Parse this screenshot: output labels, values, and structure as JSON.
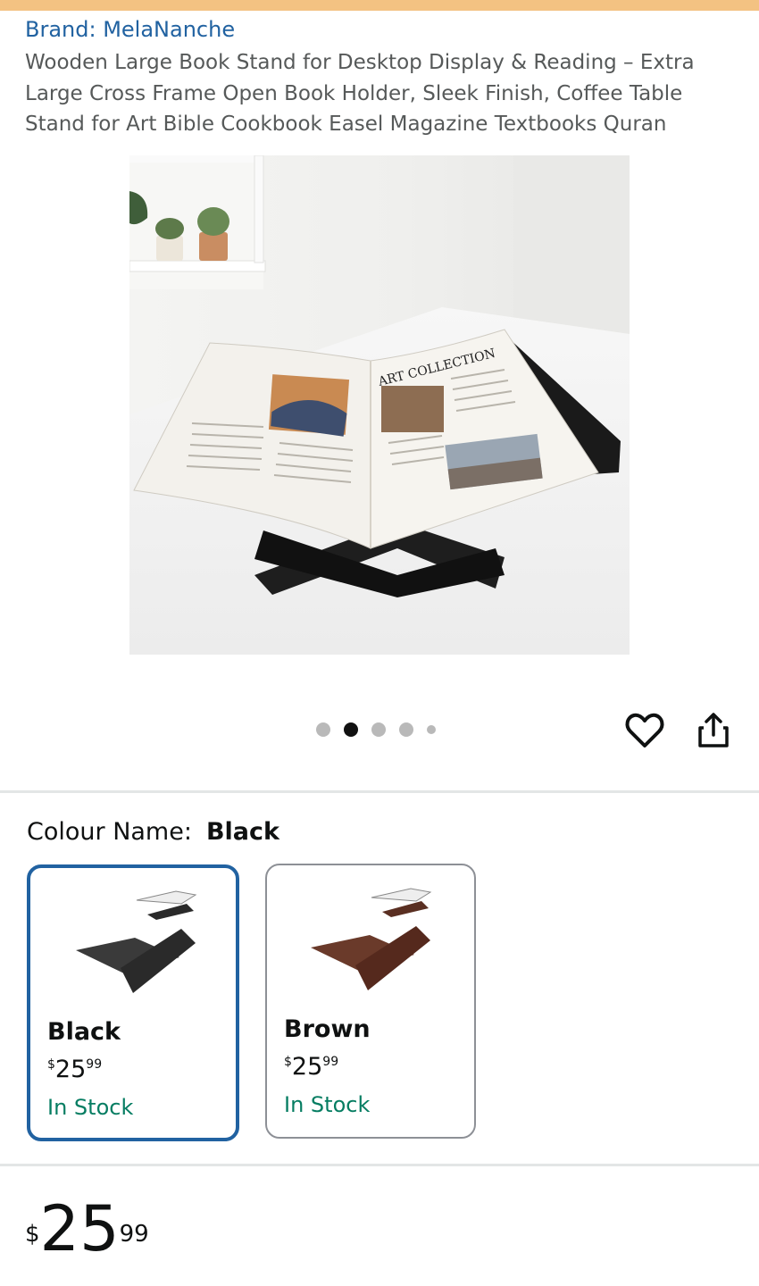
{
  "product": {
    "brand": "Brand: MelaNanche",
    "title": "Wooden Large Book Stand for Desktop Display & Reading – Extra Large Cross Frame Open Book Holder, Sleek Finish, Coffee Table Stand for Art Bible Cookbook Easel Magazine Textbooks Quran",
    "image_book_heading": "ART COLLECTION",
    "carousel": {
      "total": 5,
      "active_index": 1
    }
  },
  "colour": {
    "label": "Colour Name:",
    "selected": "Black"
  },
  "swatches": [
    {
      "name": "Black",
      "currency": "$",
      "whole": "25",
      "fraction": "99",
      "stock": "In Stock"
    },
    {
      "name": "Brown",
      "currency": "$",
      "whole": "25",
      "fraction": "99",
      "stock": "In Stock"
    }
  ],
  "price": {
    "currency": "$",
    "whole": "25",
    "fraction": "99"
  },
  "icons": {
    "wishlist": "heart-icon",
    "share": "share-icon"
  },
  "colors": {
    "accent": "#2162a1",
    "stock": "#067d62",
    "top_bar": "#f3c282"
  }
}
